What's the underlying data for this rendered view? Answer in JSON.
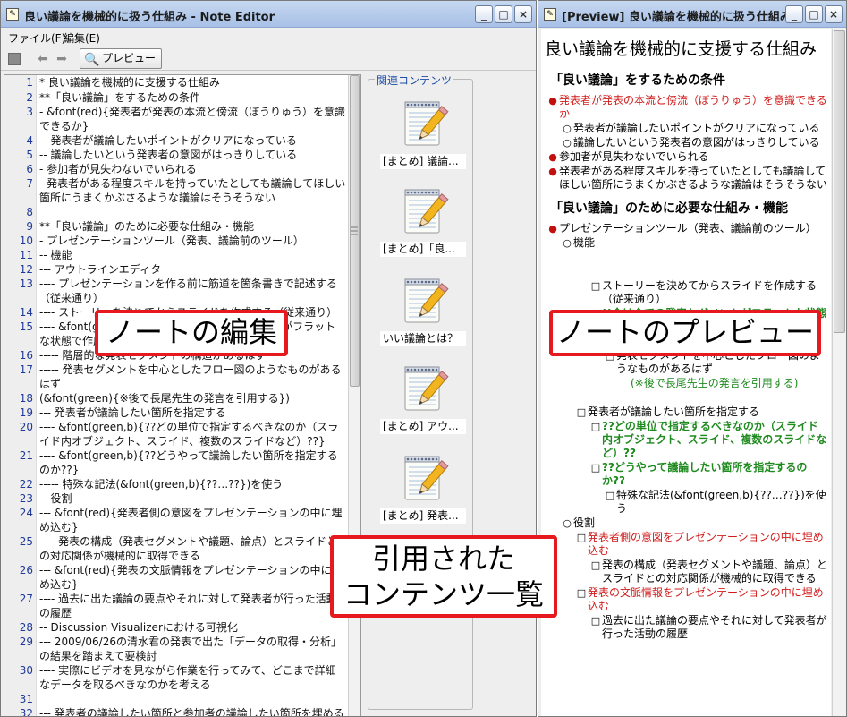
{
  "editor": {
    "title": "良い議論を機械的に扱う仕組み - Note Editor",
    "window_buttons": [
      "_",
      "□",
      "×"
    ],
    "menu": [
      "ファイル(F)",
      "編集(E)"
    ],
    "toolbar": {
      "preview_label": "プレビュー"
    },
    "lines": [
      {
        "n": "1",
        "text": "* 良い議論を機械的に支援する仕組み"
      },
      {
        "n": "2",
        "text": "**「良い議論」をするための条件"
      },
      {
        "n": "3",
        "text": "- &font(red){発表者が発表の本流と傍流（ぼうりゅう）を意識できるか}"
      },
      {
        "n": "4",
        "text": "-- 発表者が議論したいポイントがクリアになっている"
      },
      {
        "n": "5",
        "text": "-- 議論したいという発表者の意図がはっきりしている"
      },
      {
        "n": "6",
        "text": "- 参加者が見失わないでいられる"
      },
      {
        "n": "7",
        "text": "- 発表者がある程度スキルを持っていたとしても議論してほしい箇所にうまくかぶさるような議論はそうそうない"
      },
      {
        "n": "8",
        "text": ""
      },
      {
        "n": "9",
        "text": "**「良い議論」のために必要な仕組み・機能"
      },
      {
        "n": "10",
        "text": "- プレゼンテーションツール（発表、議論前のツール）"
      },
      {
        "n": "11",
        "text": "-- 機能"
      },
      {
        "n": "12",
        "text": "--- アウトラインエディタ"
      },
      {
        "n": "13",
        "text": "---- プレゼンテーションを作る前に筋道を箇条書きで記述する（従来通り）"
      },
      {
        "n": "14",
        "text": "---- ストーリーを決めてからスライドを作成する（従来通り）"
      },
      {
        "n": "15",
        "text": "---- &font(green,b){!!今は全ての発表セグメントがフラットな状態で作成されている!!}"
      },
      {
        "n": "16",
        "text": "----- 階層的な発表セグメントの構造があるはず"
      },
      {
        "n": "17",
        "text": "----- 発表セグメントを中心としたフロー図のようなものがあるはず"
      },
      {
        "n": "18",
        "text": "(&font(green){※後で長尾先生の発言を引用する})"
      },
      {
        "n": "19",
        "text": "--- 発表者が議論したい箇所を指定する"
      },
      {
        "n": "20",
        "text": "---- &font(green,b){??どの単位で指定するべきなのか（スライド内オブジェクト、スライド、複数のスライドなど）??}"
      },
      {
        "n": "21",
        "text": "---- &font(green,b){??どうやって議論したい箇所を指定するのか??}"
      },
      {
        "n": "22",
        "text": "----- 特殊な記法(&font(green,b){??…??})を使う"
      },
      {
        "n": "23",
        "text": "-- 役割"
      },
      {
        "n": "24",
        "text": "--- &font(red){発表者側の意図をプレゼンテーションの中に埋め込む}"
      },
      {
        "n": "25",
        "text": "---- 発表の構成（発表セグメントや議題、論点）とスライドとの対応関係が機械的に取得できる"
      },
      {
        "n": "26",
        "text": "--- &font(red){発表の文脈情報をプレゼンテーションの中に埋め込む}"
      },
      {
        "n": "27",
        "text": "---- 過去に出た議論の要点やそれに対して発表者が行った活動の履歴"
      },
      {
        "n": "28",
        "text": "-- Discussion Visualizerにおける可視化"
      },
      {
        "n": "29",
        "text": "--- 2009/06/26の清水君の発表で出た「データの取得・分析」の結果を踏まえて要検討"
      },
      {
        "n": "30",
        "text": "---- 実際にビデオを見ながら作業を行ってみて、どこまで詳細なデータを取るべきなのかを考える"
      },
      {
        "n": "31",
        "text": ""
      },
      {
        "n": "32",
        "text": "--- 発表者の議論したい箇所と参加者の議論したい箇所を埋める"
      }
    ]
  },
  "related": {
    "title": "関連コンテンツ",
    "items": [
      {
        "caption": "[まとめ] 議論..."
      },
      {
        "caption": "[まとめ]「良..."
      },
      {
        "caption": "いい議論とは？"
      },
      {
        "caption": "[まとめ] アウ..."
      },
      {
        "caption": "[まとめ] 発表..."
      }
    ]
  },
  "callouts": {
    "edit": "ノートの編集",
    "related_line1": "引用された",
    "related_line2": "コンテンツ一覧",
    "preview": "ノートのプレビュー"
  },
  "preview": {
    "title": "[Preview] 良い議論を機械的に扱う仕組み",
    "h1": "良い議論を機械的に支援する仕組み",
    "h2_a": "「良い議論」をするための条件",
    "h2_b": "「良い議論」のために必要な仕組み・機能",
    "items_a": [
      {
        "bullet": "●",
        "indent": 0,
        "color": "red",
        "bold": false,
        "text": "発表者が発表の本流と傍流（ぼうりゅう）を意識できるか"
      },
      {
        "bullet": "○",
        "indent": 1,
        "color": "",
        "bold": false,
        "text": "発表者が議論したいポイントがクリアになっている"
      },
      {
        "bullet": "○",
        "indent": 1,
        "color": "",
        "bold": false,
        "text": "議論したいという発表者の意図がはっきりしている"
      },
      {
        "bullet": "●",
        "indent": 0,
        "color": "",
        "bold": false,
        "text": "参加者が見失わないでいられる"
      },
      {
        "bullet": "●",
        "indent": 0,
        "color": "",
        "bold": false,
        "text": "発表者がある程度スキルを持っていたとしても議論してほしい箇所にうまくかぶさるような議論はそうそうない"
      }
    ],
    "items_b": [
      {
        "bullet": "●",
        "indent": 0,
        "color": "",
        "bold": false,
        "text": "プレゼンテーションツール（発表、議論前のツール）"
      },
      {
        "bullet": "○",
        "indent": 1,
        "color": "",
        "bold": false,
        "text": "機能"
      },
      {
        "bullet": "",
        "indent": 0,
        "color": "",
        "bold": false,
        "text": ""
      },
      {
        "bullet": "",
        "indent": 0,
        "color": "",
        "bold": false,
        "text": ""
      },
      {
        "bullet": "□",
        "indent": 3,
        "color": "",
        "bold": false,
        "text": "ストーリーを決めてからスライドを作成する（従来通り）"
      },
      {
        "bullet": "□",
        "indent": 3,
        "color": "green",
        "bold": true,
        "text": "!!今は全ての発表セグメントがフラットな状態で作成されている!!"
      },
      {
        "bullet": "□",
        "indent": 4,
        "color": "",
        "bold": false,
        "text": "階層的な発表セグメントの構造があるはず"
      },
      {
        "bullet": "□",
        "indent": 4,
        "color": "",
        "bold": false,
        "text": "発表セグメントを中心としたフロー図のようなものがあるはず"
      },
      {
        "bullet": "",
        "indent": 5,
        "color": "green",
        "bold": false,
        "text": "(※後で長尾先生の発言を引用する)"
      },
      {
        "bullet": "",
        "indent": 0,
        "color": "",
        "bold": false,
        "text": ""
      },
      {
        "bullet": "□",
        "indent": 2,
        "color": "",
        "bold": false,
        "text": "発表者が議論したい箇所を指定する"
      },
      {
        "bullet": "□",
        "indent": 3,
        "color": "green",
        "bold": true,
        "text": "??どの単位で指定するべきなのか（スライド内オブジェクト、スライド、複数のスライドなど）??"
      },
      {
        "bullet": "□",
        "indent": 3,
        "color": "green",
        "bold": true,
        "text": "??どうやって議論したい箇所を指定するのか??"
      },
      {
        "bullet": "□",
        "indent": 4,
        "color": "",
        "bold": false,
        "text": "特殊な記法(&font(green,b){??…??})を使う"
      },
      {
        "bullet": "○",
        "indent": 1,
        "color": "",
        "bold": false,
        "text": "役割"
      },
      {
        "bullet": "□",
        "indent": 2,
        "color": "red",
        "bold": false,
        "text": "発表者側の意図をプレゼンテーションの中に埋め込む"
      },
      {
        "bullet": "□",
        "indent": 3,
        "color": "",
        "bold": false,
        "text": "発表の構成（発表セグメントや議題、論点）とスライドとの対応関係が機械的に取得できる"
      },
      {
        "bullet": "□",
        "indent": 2,
        "color": "red",
        "bold": false,
        "text": "発表の文脈情報をプレゼンテーションの中に埋め込む"
      },
      {
        "bullet": "□",
        "indent": 3,
        "color": "",
        "bold": false,
        "text": "過去に出た議論の要点やそれに対して発表者が行った活動の履歴"
      }
    ]
  },
  "colors": {
    "callout_border": "#e6191e",
    "red_text": "#d11b1b",
    "green_text": "#1f8a1f",
    "line_number": "#1f3a9a",
    "related_title": "#1f4fa8"
  },
  "icons": {
    "note": "notepad-pencil-icon",
    "preview": "magnifier-icon",
    "undo": "undo-arrow-icon",
    "redo": "redo-arrow-icon",
    "stop": "stop-icon"
  }
}
